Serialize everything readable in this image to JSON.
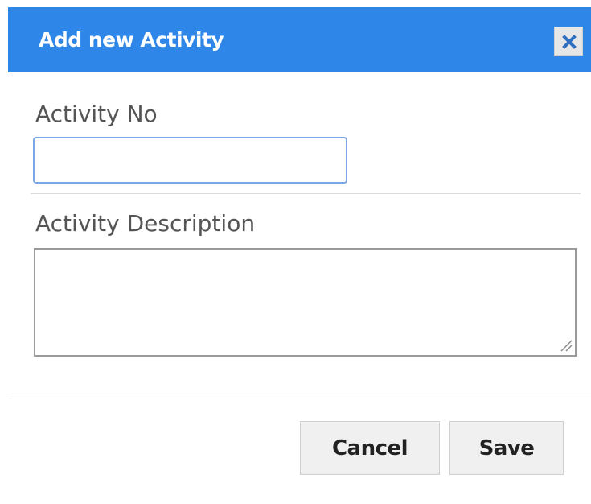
{
  "dialog": {
    "title": "Add new Activity",
    "close_icon": "close-icon",
    "accent_color": "#2e87e8"
  },
  "form": {
    "activity_no": {
      "label": "Activity No",
      "value": ""
    },
    "activity_description": {
      "label": "Activity Description",
      "value": ""
    }
  },
  "footer": {
    "cancel_label": "Cancel",
    "save_label": "Save"
  }
}
